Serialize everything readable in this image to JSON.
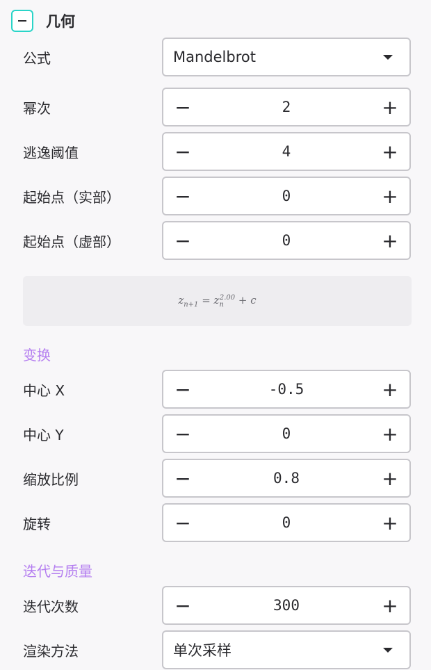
{
  "section": {
    "title": "几何"
  },
  "formula_row": {
    "label": "公式",
    "value": "Mandelbrot"
  },
  "geometry": [
    {
      "label": "幂次",
      "value": "2"
    },
    {
      "label": "逃逸阈值",
      "value": "4"
    },
    {
      "label": "起始点（实部）",
      "value": "0"
    },
    {
      "label": "起始点（虚部）",
      "value": "0"
    }
  ],
  "equation": {
    "z": "z",
    "sub_left": "n+1",
    "eq": " = ",
    "z2": "z",
    "sub_right": "n",
    "power": "2.00",
    "rest": " + c"
  },
  "transform": {
    "title": "变换",
    "items": [
      {
        "label": "中心 X",
        "value": "-0.5"
      },
      {
        "label": "中心 Y",
        "value": "0"
      },
      {
        "label": "缩放比例",
        "value": "0.8"
      },
      {
        "label": "旋转",
        "value": "0"
      }
    ]
  },
  "iteration": {
    "title": "迭代与质量",
    "iterations": {
      "label": "迭代次数",
      "value": "300"
    },
    "render": {
      "label": "渲染方法",
      "value": "单次采样"
    }
  },
  "icons": {
    "minus": "−",
    "plus": "+"
  },
  "colors": {
    "accent_teal": "#2ad4c8",
    "group_purple": "#b57ff0"
  }
}
